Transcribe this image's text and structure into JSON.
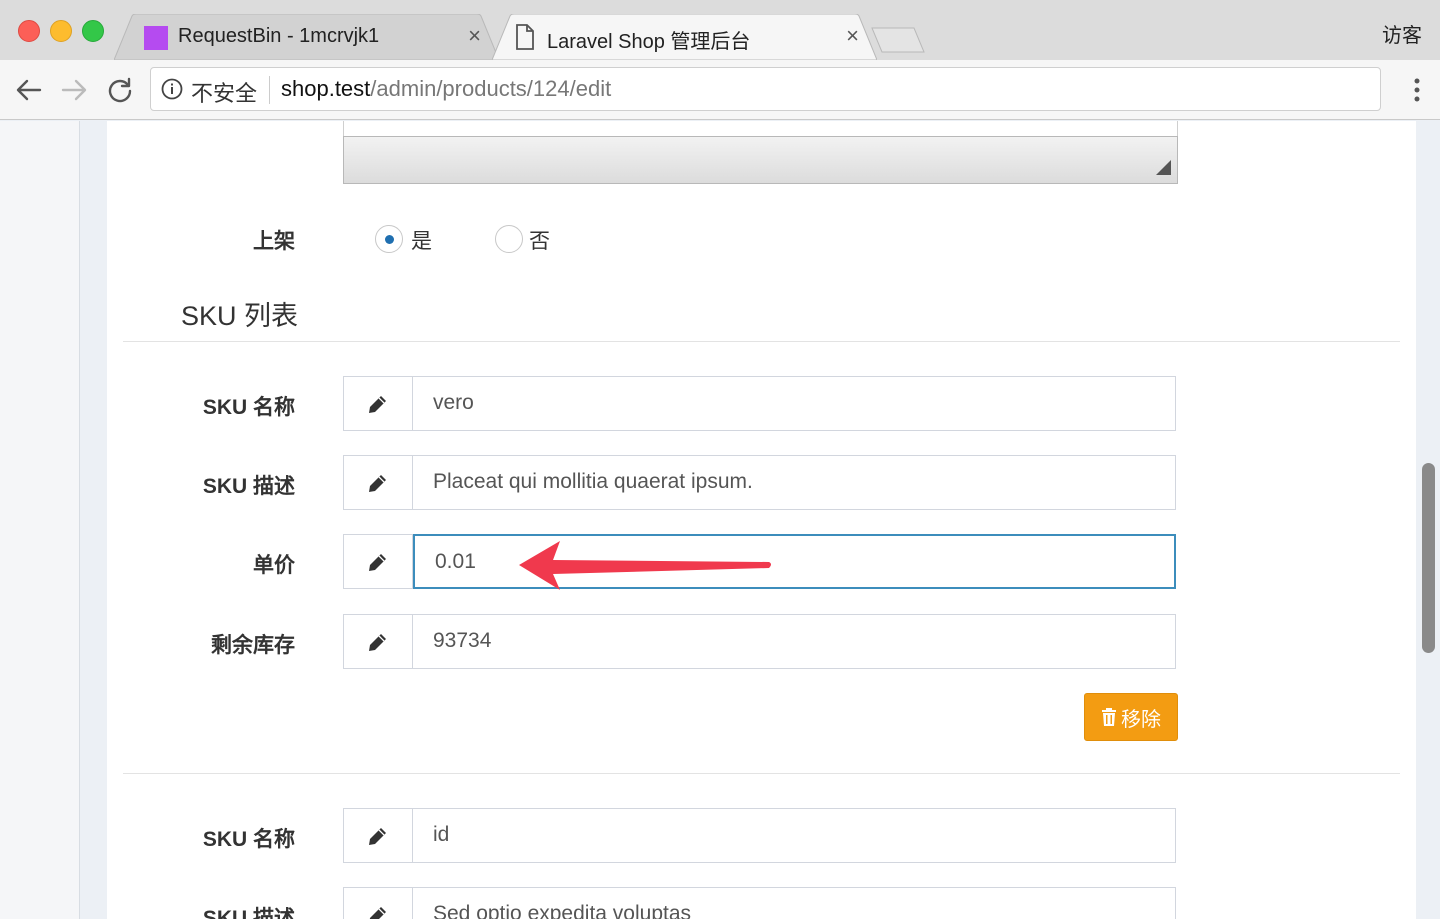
{
  "browser": {
    "tabs": [
      {
        "title": "RequestBin - 1mcrvjk1",
        "active": false
      },
      {
        "title": "Laravel Shop 管理后台",
        "active": true
      }
    ],
    "guest_label": "访客",
    "security_label": "不安全",
    "url_host": "shop.test",
    "url_path": "/admin/products/124/edit"
  },
  "form": {
    "on_sale_label": "上架",
    "on_sale_options": [
      {
        "label": "是",
        "checked": true
      },
      {
        "label": "否",
        "checked": false
      }
    ],
    "sku_section_title": "SKU 列表",
    "skus": [
      {
        "fields": [
          {
            "label": "SKU 名称",
            "value": "vero"
          },
          {
            "label": "SKU 描述",
            "value": "Placeat qui mollitia quaerat ipsum."
          },
          {
            "label": "单价",
            "value": "0.01",
            "focused": true
          },
          {
            "label": "剩余库存",
            "value": "93734"
          }
        ],
        "remove_label": "移除"
      },
      {
        "fields": [
          {
            "label": "SKU 名称",
            "value": "id"
          },
          {
            "label": "SKU 描述",
            "value": "Sed optio expedita voluptas"
          }
        ]
      }
    ]
  },
  "colors": {
    "remove_button": "#f39c12",
    "focus_border": "#3c8dbc",
    "annotation_arrow": "#f0394d"
  }
}
